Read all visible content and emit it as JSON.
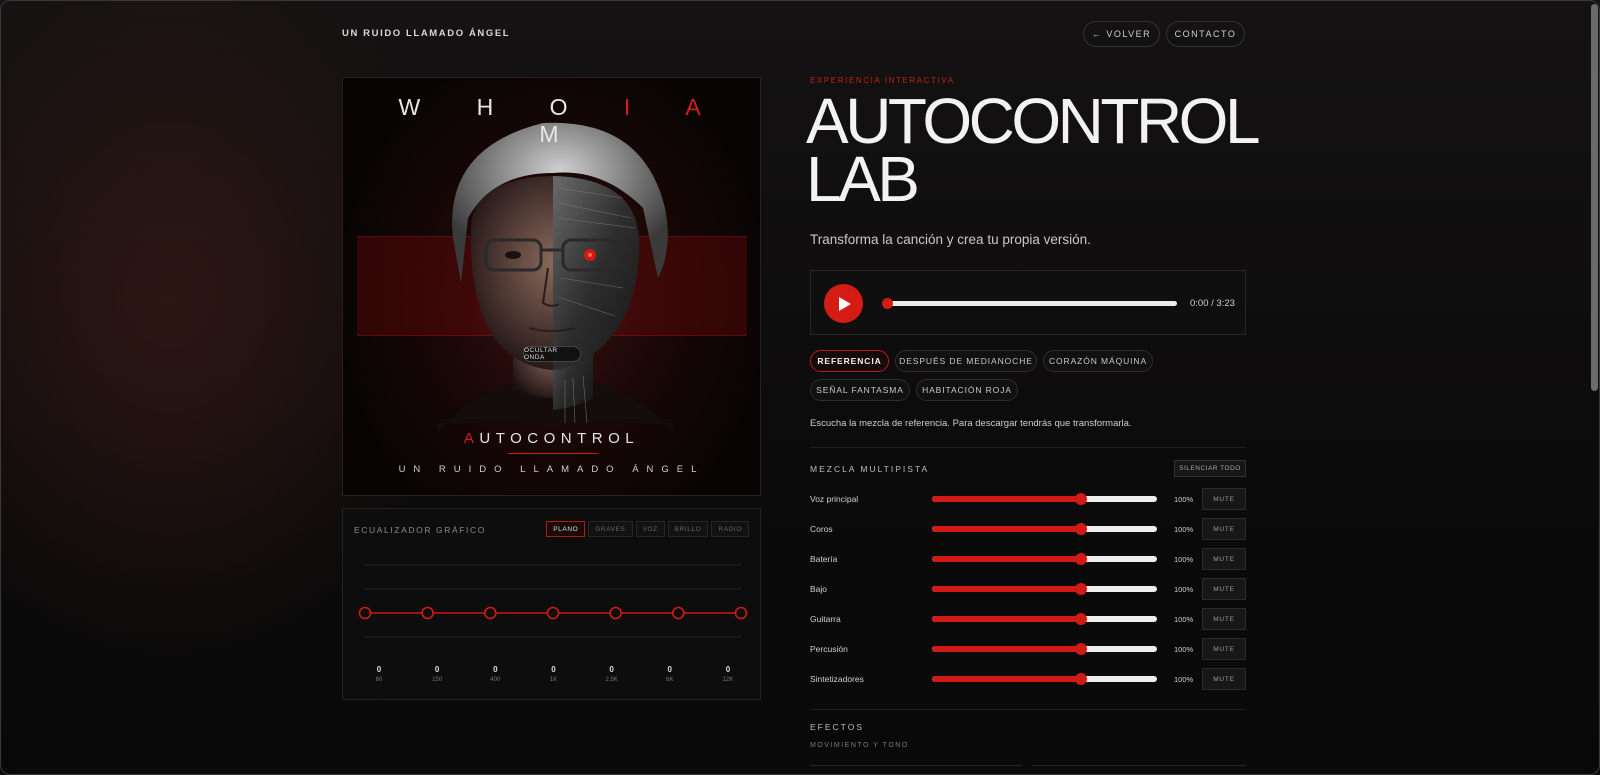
{
  "header": {
    "brand": "UN RUIDO LLAMADO ÁNGEL",
    "back_label": "← VOLVER",
    "contact_label": "CONTACTO"
  },
  "album": {
    "title_parts": [
      "W H O",
      " I ",
      " A",
      " M"
    ],
    "name_first": "A",
    "name_rest": "UTOCONTROL",
    "subtitle": "UN RUIDO LLAMADO ÁNGEL",
    "hide_wave_label": "OCULTAR ONDA"
  },
  "equalizer": {
    "title": "ECUALIZADOR GRÁFICO",
    "presets": [
      "PLANO",
      "GRAVES",
      "VOZ",
      "BRILLO",
      "RADIO"
    ],
    "active_preset": "PLANO",
    "bands": [
      {
        "value": "0",
        "freq": "60"
      },
      {
        "value": "0",
        "freq": "150"
      },
      {
        "value": "0",
        "freq": "400"
      },
      {
        "value": "0",
        "freq": "1K"
      },
      {
        "value": "0",
        "freq": "2.5K"
      },
      {
        "value": "0",
        "freq": "6K"
      },
      {
        "value": "0",
        "freq": "12K"
      }
    ]
  },
  "hero": {
    "kicker": "EXPERIENCIA INTERACTIVA",
    "title_line1": "AUTOCONTROL",
    "title_line2": "LAB",
    "subtitle": "Transforma la canción y crea tu propia versión."
  },
  "player": {
    "time": "0:00 / 3:23",
    "progress": 0
  },
  "mixes": {
    "items": [
      "REFERENCIA",
      "DESPUÉS DE MEDIANOCHE",
      "CORAZÓN MÁQUINA",
      "SEÑAL FANTASMA",
      "HABITACIÓN ROJA"
    ],
    "active": "REFERENCIA",
    "note": "Escucha la mezcla de referencia. Para descargar tendrás que transformarla."
  },
  "multitrack": {
    "title": "MEZCLA MULTIPISTA",
    "mute_all_label": "SILENCIAR TODO",
    "mute_label": "MUTE",
    "tracks": [
      {
        "name": "Voz principal",
        "percent": "100%",
        "level": 0.66
      },
      {
        "name": "Coros",
        "percent": "100%",
        "level": 0.66
      },
      {
        "name": "Batería",
        "percent": "100%",
        "level": 0.66
      },
      {
        "name": "Bajo",
        "percent": "100%",
        "level": 0.66
      },
      {
        "name": "Guitarra",
        "percent": "100%",
        "level": 0.66
      },
      {
        "name": "Percusión",
        "percent": "100%",
        "level": 0.66
      },
      {
        "name": "Sintetizadores",
        "percent": "100%",
        "level": 0.66
      }
    ]
  },
  "effects": {
    "title": "EFECTOS",
    "subtitle": "MOVIMIENTO Y TONO"
  }
}
